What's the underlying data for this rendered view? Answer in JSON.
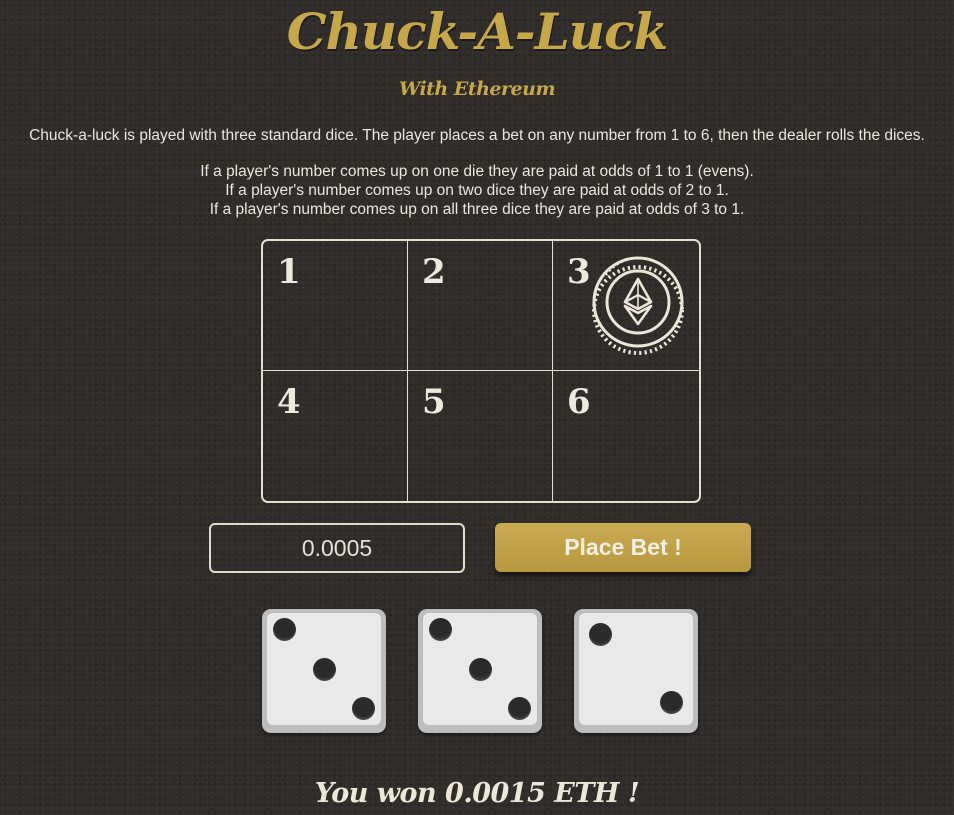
{
  "header": {
    "title": "Chuck-A-Luck",
    "subtitle": "With Ethereum"
  },
  "description": {
    "intro": "Chuck-a-luck is played with three standard dice. The player places a bet on any number from 1 to 6, then the dealer rolls the dices.",
    "rules": [
      "If a player's number comes up on one die they are paid at odds of 1 to 1 (evens).",
      "If a player's number comes up on two dice they are paid at odds of 2 to 1.",
      "If a player's number comes up on all three dice they are paid at odds of 3 to 1."
    ]
  },
  "board": {
    "cells": [
      {
        "number": "1",
        "has_bet": false
      },
      {
        "number": "2",
        "has_bet": false
      },
      {
        "number": "3",
        "has_bet": true
      },
      {
        "number": "4",
        "has_bet": false
      },
      {
        "number": "5",
        "has_bet": false
      },
      {
        "number": "6",
        "has_bet": false
      }
    ],
    "bet_marker_icon": "ethereum-coin-icon"
  },
  "bet": {
    "amount_value": "0.0005",
    "button_label": "Place Bet !"
  },
  "dice": [
    {
      "value": 3
    },
    {
      "value": 3
    },
    {
      "value": 2
    }
  ],
  "result": {
    "message": "You won 0.0015 ETH !"
  },
  "colors": {
    "background": "#2f2c2a",
    "gold_accent": "#c6a84a",
    "button": "#c2a349",
    "board_lines": "#e6dfcf",
    "die_face": "#e9e9e9",
    "pip": "#2a2a2a"
  }
}
